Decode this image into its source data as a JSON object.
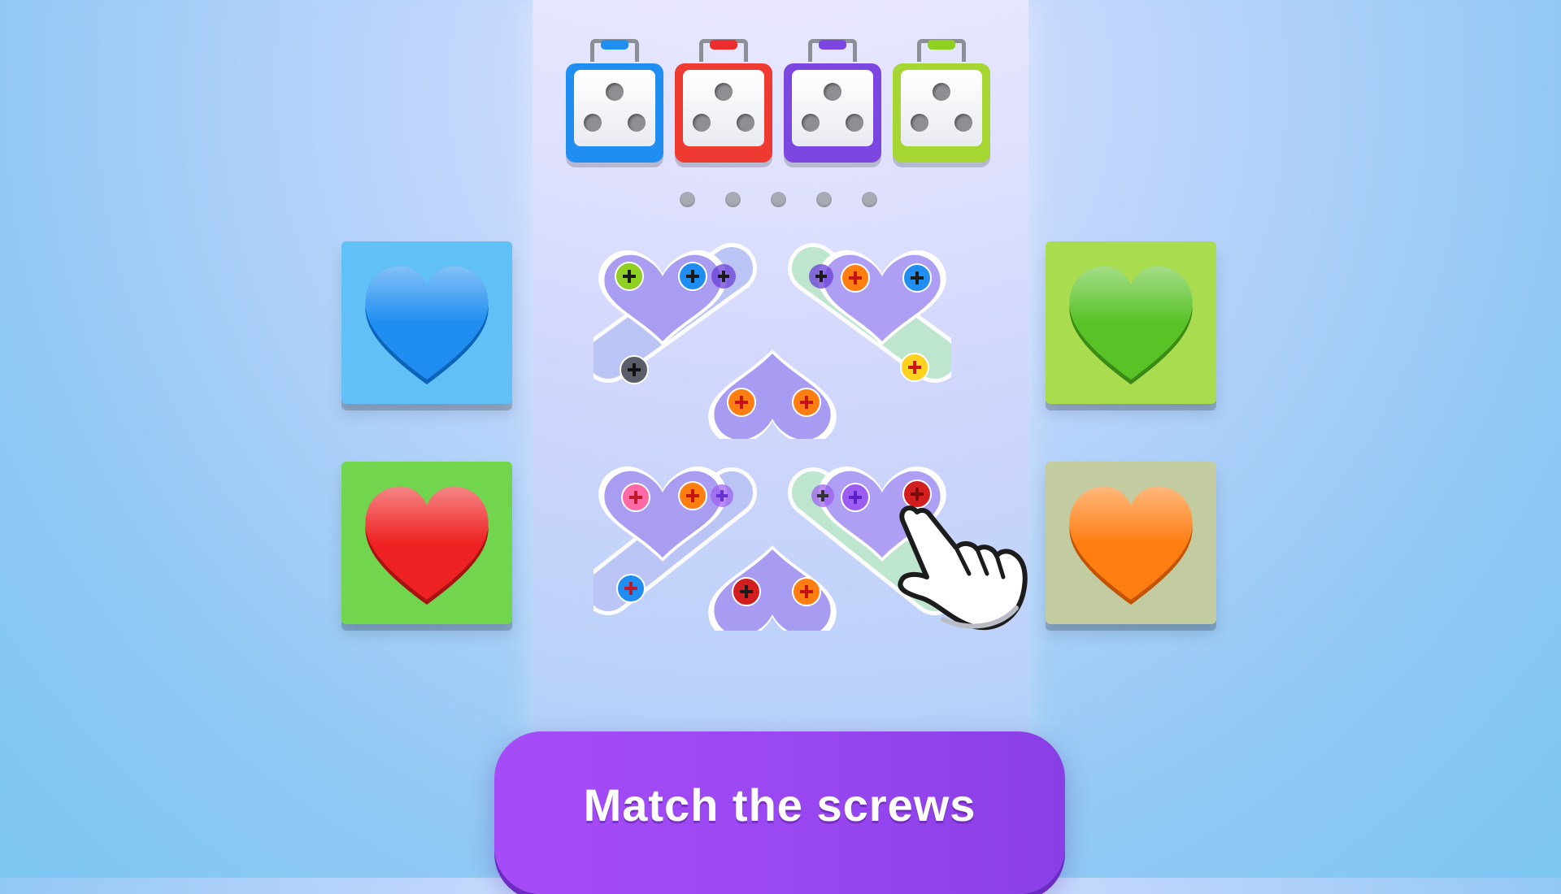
{
  "hint_button": {
    "label": "Match the screws"
  },
  "colors": {
    "blue": "#1f8ef0",
    "red": "#ee2e2e",
    "purple": "#7b47e0",
    "lime": "#8fd023",
    "green": "#58c227",
    "orange": "#ff7e12",
    "yellow": "#ffd21f",
    "pink": "#ff6aa6",
    "gray": "#5b5e68",
    "violet": "#9b5cf0",
    "button": "#9c48f2"
  },
  "screw_boxes": [
    {
      "color": "blue",
      "holes": 3
    },
    {
      "color": "red",
      "holes": 3
    },
    {
      "color": "purple",
      "holes": 3
    },
    {
      "color": "lime",
      "holes": 3
    }
  ],
  "empty_slots": 5,
  "heart_tiles": [
    {
      "tile_color": "#61c0f5",
      "heart_color": "blue"
    },
    {
      "tile_color": "#a9dc4f",
      "heart_color": "green"
    },
    {
      "tile_color": "#72d54e",
      "heart_color": "red"
    },
    {
      "tile_color": "#c2cca0",
      "heart_color": "orange"
    }
  ],
  "puzzle_groups": [
    {
      "screws": [
        "lime",
        "blue",
        "purple",
        "purple",
        "orange",
        "blue",
        "gray",
        "orange",
        "orange",
        "yellow"
      ]
    },
    {
      "screws": [
        "pink",
        "orange",
        "violet",
        "violet",
        "violet",
        "red",
        "blue",
        "red",
        "orange"
      ]
    }
  ],
  "pointer": "hand-pointer-icon"
}
